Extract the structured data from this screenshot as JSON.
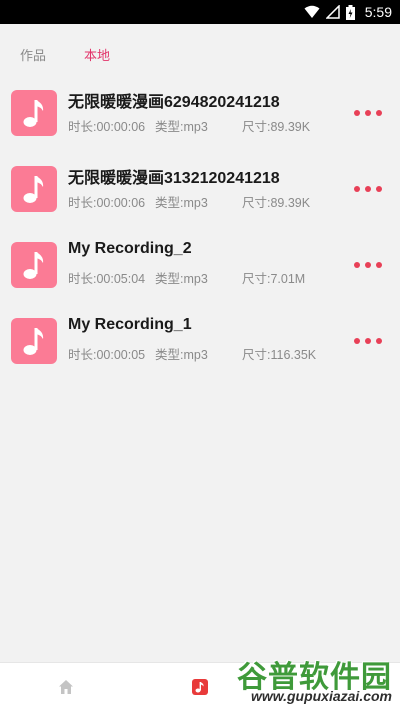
{
  "status_bar": {
    "time": "5:59",
    "icons": [
      "wifi-icon",
      "signal-icon",
      "battery-icon"
    ]
  },
  "tabs": [
    {
      "label": "作品",
      "active": false
    },
    {
      "label": "本地",
      "active": true
    }
  ],
  "recordings": [
    {
      "title": "无限暖暖漫画6294820241218",
      "duration": "时长:00:00:06",
      "type": "类型:mp3",
      "size": "尺寸:89.39K"
    },
    {
      "title": "无限暖暖漫画3132120241218",
      "duration": "时长:00:00:06",
      "type": "类型:mp3",
      "size": "尺寸:89.39K"
    },
    {
      "title": "My Recording_2",
      "duration": "时长:00:05:04",
      "type": "类型:mp3",
      "size": "尺寸:7.01M"
    },
    {
      "title": "My Recording_1",
      "duration": "时长:00:00:05",
      "type": "类型:mp3",
      "size": "尺寸:116.35K"
    }
  ],
  "bottom_nav": [
    {
      "icon": "home-icon"
    },
    {
      "icon": "music-note-icon"
    }
  ],
  "watermark": {
    "title": "谷普软件园",
    "url": "www.gupuxiazai.com"
  },
  "colors": {
    "accent": "#e2346a",
    "thumb": "#fb7b95",
    "more_dots": "#e84057",
    "watermark_green": "#3f9a3a"
  }
}
